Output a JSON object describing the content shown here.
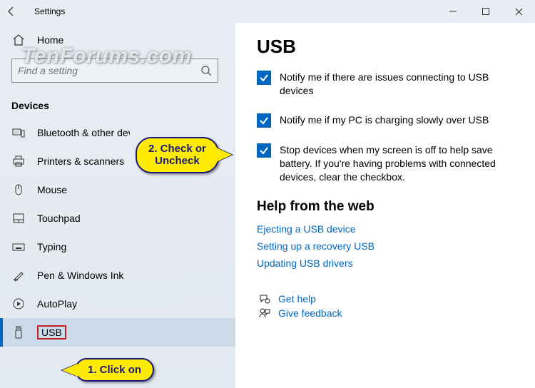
{
  "titlebar": {
    "title": "Settings"
  },
  "sidebar": {
    "home": "Home",
    "search_placeholder": "Find a setting",
    "section": "Devices",
    "items": [
      {
        "label": "Bluetooth & other devices"
      },
      {
        "label": "Printers & scanners"
      },
      {
        "label": "Mouse"
      },
      {
        "label": "Touchpad"
      },
      {
        "label": "Typing"
      },
      {
        "label": "Pen & Windows Ink"
      },
      {
        "label": "AutoPlay"
      },
      {
        "label": "USB"
      }
    ]
  },
  "main": {
    "title": "USB",
    "checks": [
      "Notify me if there are issues connecting to USB devices",
      "Notify me if my PC is charging slowly over USB",
      "Stop devices when my screen is off to help save battery. If you're having problems with connected devices, clear the checkbox."
    ],
    "help_header": "Help from the web",
    "help_links": [
      "Ejecting a USB device",
      "Setting up a recovery USB",
      "Updating USB drivers"
    ],
    "get_help": "Get help",
    "feedback": "Give feedback"
  },
  "annotations": {
    "step1": "1. Click on",
    "step2": "2. Check or\nUncheck"
  },
  "watermark": "TenForums.com"
}
